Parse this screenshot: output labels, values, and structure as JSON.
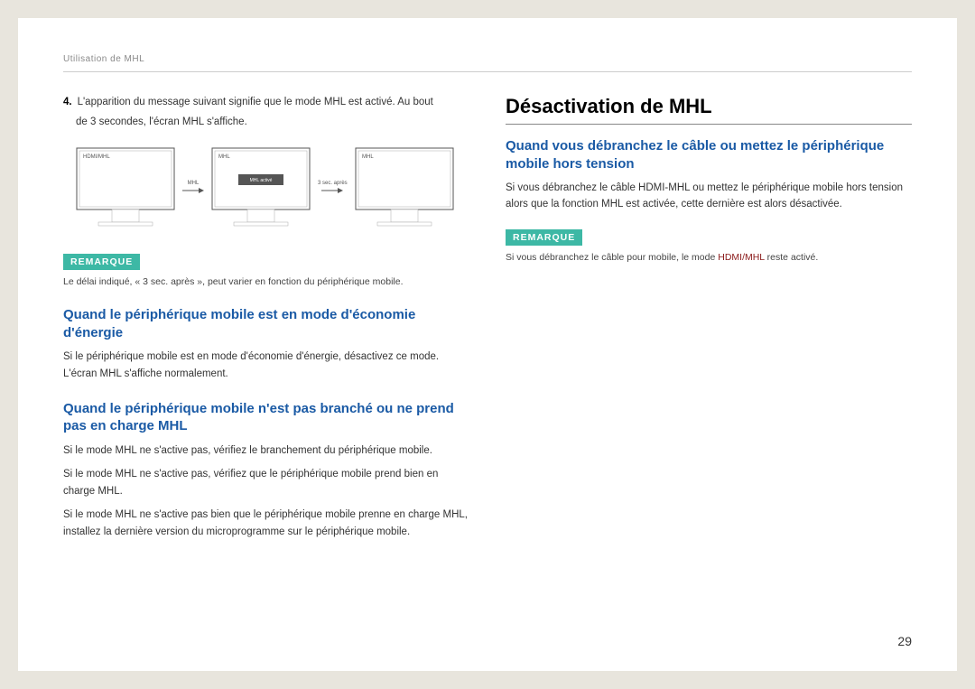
{
  "header": {
    "breadcrumb": "Utilisation de MHL"
  },
  "left": {
    "step4": {
      "num": "4.",
      "text": "L'apparition du message suivant signifie que le mode MHL est activé. Au bout",
      "sub": "de 3 secondes, l'écran MHL s'affiche."
    },
    "monitors": {
      "m1_label": "HDMI/MHL",
      "arrow1_label": "MHL",
      "m2_label": "MHL",
      "m2_bar": "MHL activé",
      "arrow2_label": "3 sec. après",
      "m3_label": "MHL"
    },
    "remarque_label": "REMARQUE",
    "remarque_text": "Le délai indiqué, « 3 sec. après », peut varier en fonction du périphérique mobile.",
    "h2a": "Quand le périphérique mobile est en mode d'économie d'énergie",
    "p2a": "Si le périphérique mobile est en mode d'économie d'énergie, désactivez ce mode. L'écran MHL s'affiche normalement.",
    "h2b": "Quand le périphérique mobile n'est pas branché ou ne prend pas en charge MHL",
    "p2b1": "Si le mode MHL ne s'active pas, vérifiez le branchement du périphérique mobile.",
    "p2b2": "Si le mode MHL ne s'active pas, vérifiez que le périphérique mobile prend bien en charge MHL.",
    "p2b3": "Si le mode MHL ne s'active pas bien que le périphérique mobile prenne en charge MHL, installez la dernière version du microprogramme sur le périphérique mobile."
  },
  "right": {
    "h1": "Désactivation de MHL",
    "h2": "Quand vous débranchez le câble ou mettez le périphérique mobile hors tension",
    "p1": "Si vous débranchez le câble HDMI-MHL ou mettez le périphérique mobile hors tension alors que la fonction MHL est activée, cette dernière est alors désactivée.",
    "remarque_label": "REMARQUE",
    "remarque_pre": "Si vous débranchez le câble pour mobile, le mode ",
    "remarque_hl": "HDMI/MHL",
    "remarque_post": " reste activé."
  },
  "page_number": "29"
}
